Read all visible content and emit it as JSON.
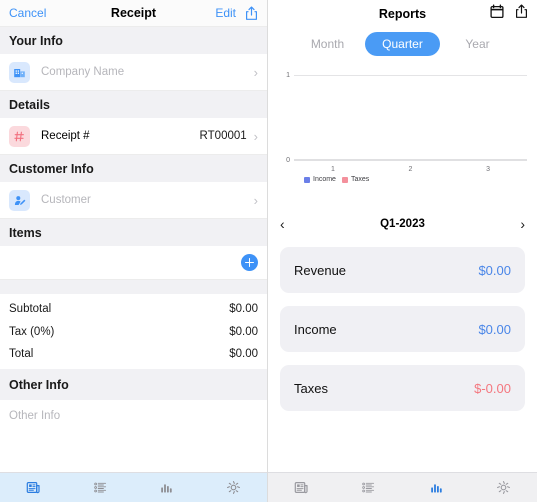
{
  "left_panel": {
    "navbar": {
      "cancel_label": "Cancel",
      "title": "Receipt",
      "edit_label": "Edit",
      "share_icon": "share-icon"
    },
    "sections": [
      {
        "header": "Your Info"
      },
      {
        "header": "Details"
      },
      {
        "header": "Customer Info"
      },
      {
        "header": "Items"
      },
      {
        "header": "Other Info"
      }
    ],
    "your_info": {
      "header": "Your Info",
      "company_row": {
        "icon": "company-building-icon",
        "placeholder": "Company Name",
        "chevron": "chevron-right-icon"
      }
    },
    "details": {
      "header": "Details",
      "receipt_row": {
        "icon": "hash-number-icon",
        "label": "Receipt #",
        "value": "RT00001",
        "chevron": "chevron-right-icon"
      }
    },
    "customer_info": {
      "header": "Customer Info",
      "customer_row": {
        "icon": "person-edit-icon",
        "placeholder": "Customer",
        "chevron": "chevron-right-icon"
      }
    },
    "items": {
      "header": "Items",
      "add_button": "add-item-button"
    },
    "totals": [
      {
        "label": "Subtotal",
        "amount": "$0.00"
      },
      {
        "label": "Tax (0%)",
        "amount": "$0.00"
      },
      {
        "label": "Total",
        "amount": "$0.00"
      }
    ],
    "other_info": {
      "header": "Other Info",
      "placeholder": "Other Info"
    },
    "tabbar": {
      "items": [
        {
          "icon": "receipt-icon",
          "active": true
        },
        {
          "icon": "list-icon",
          "active": false
        },
        {
          "icon": "bar-chart-icon",
          "active": false
        },
        {
          "icon": "gear-icon",
          "active": false
        }
      ]
    }
  },
  "right_panel": {
    "navbar": {
      "title": "Reports",
      "calendar_icon": "calendar-icon",
      "share_icon": "share-icon"
    },
    "segmented": {
      "options": [
        "Month",
        "Quarter",
        "Year"
      ],
      "selected": "Quarter"
    },
    "period": {
      "prev_label": "‹",
      "label": "Q1-2023",
      "next_label": "›"
    },
    "cards": [
      {
        "label": "Revenue",
        "value": "$0.00",
        "color": "#4a86e8"
      },
      {
        "label": "Income",
        "value": "$0.00",
        "color": "#4a86e8"
      },
      {
        "label": "Taxes",
        "value": "$-0.00",
        "color": "#f4777f"
      }
    ],
    "tabbar": {
      "items": [
        {
          "icon": "receipt-icon",
          "active": false
        },
        {
          "icon": "list-icon",
          "active": false
        },
        {
          "icon": "bar-chart-icon",
          "active": true
        },
        {
          "icon": "gear-icon",
          "active": false
        }
      ]
    }
  },
  "colors": {
    "accent_blue": "#3e92f7",
    "segment_blue": "#4a9bf5",
    "value_blue": "#4a86e8",
    "value_red": "#f4777f",
    "legend_income": "#6b7fe8",
    "legend_taxes": "#f4909c",
    "section_bg": "#f1f1f4",
    "card_bg": "#f0f0f4",
    "tabbar_left_bg": "#dcedfb",
    "tabbar_right_bg": "#f0f0f2"
  },
  "chart_data": {
    "type": "bar",
    "title": "",
    "xlabel": "",
    "ylabel": "",
    "categories": [
      "1",
      "2",
      "3"
    ],
    "x_ticks": [
      "1",
      "2",
      "3"
    ],
    "y_ticks": [
      "0",
      "1"
    ],
    "ylim": [
      0,
      1
    ],
    "grid": true,
    "legend_position": "bottom-left",
    "series": [
      {
        "name": "Income",
        "color": "#6b7fe8",
        "values": [
          0,
          0,
          0
        ]
      },
      {
        "name": "Taxes",
        "color": "#f4909c",
        "values": [
          0,
          0,
          0
        ]
      }
    ]
  }
}
